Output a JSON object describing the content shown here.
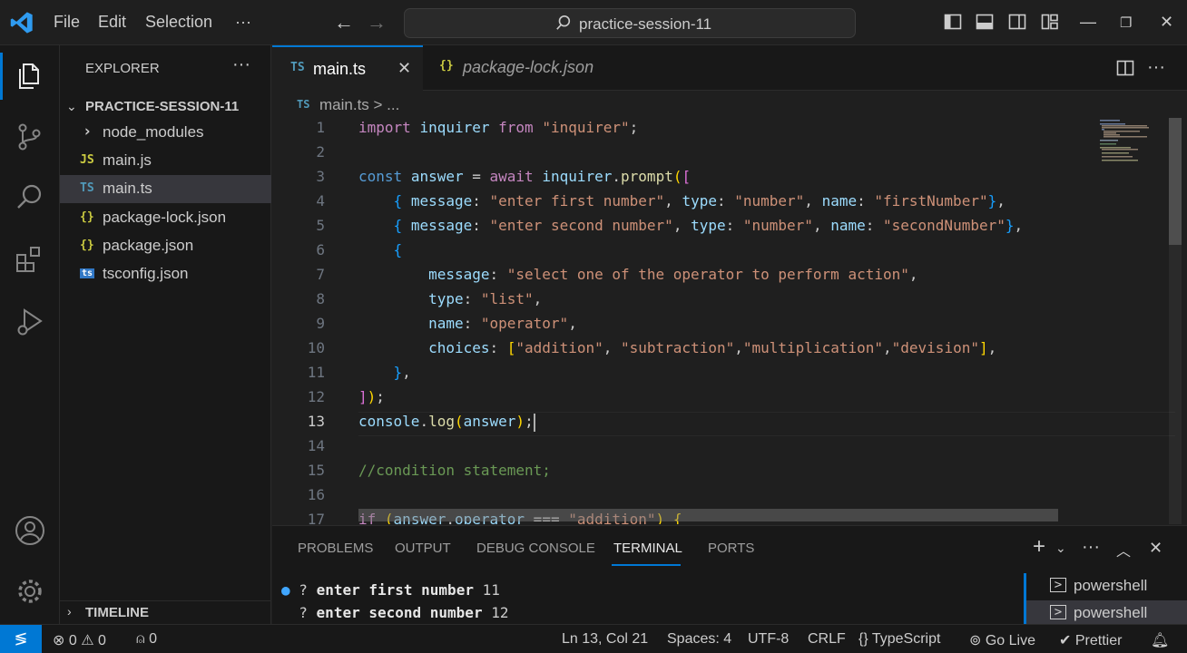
{
  "menu": {
    "file": "File",
    "edit": "Edit",
    "selection": "Selection",
    "more": "···"
  },
  "command_center": {
    "text": "practice-session-11"
  },
  "explorer": {
    "title": "EXPLORER",
    "more": "···",
    "folder": "PRACTICE-SESSION-11",
    "items": [
      {
        "icon": "›",
        "name": "node_modules"
      },
      {
        "icon": "JS",
        "name": "main.js"
      },
      {
        "icon": "TS",
        "name": "main.ts"
      },
      {
        "icon": "{}",
        "name": "package-lock.json"
      },
      {
        "icon": "{}",
        "name": "package.json"
      },
      {
        "icon": "ts",
        "name": "tsconfig.json"
      }
    ],
    "timeline": "TIMELINE"
  },
  "tabs": [
    {
      "icon": "TS",
      "label": "main.ts",
      "close": "✕"
    },
    {
      "icon": "{}",
      "label": "package-lock.json"
    }
  ],
  "breadcrumb": {
    "icon": "TS",
    "path": "main.ts > ..."
  },
  "editor": {
    "line_numbers": [
      "1",
      "2",
      "3",
      "4",
      "5",
      "6",
      "7",
      "8",
      "9",
      "10",
      "11",
      "12",
      "13",
      "14",
      "15",
      "16",
      "17"
    ],
    "lines": [
      "import inquirer from \"inquirer\";",
      "",
      "const answer = await inquirer.prompt([",
      "    { message: \"enter first number\", type: \"number\", name: \"firstNumber\"},",
      "    { message: \"enter second number\", type: \"number\", name: \"secondNumber\"},",
      "    {",
      "        message: \"select one of the operator to perform action\",",
      "        type: \"list\",",
      "        name: \"operator\",",
      "        choices: [\"addition\", \"subtraction\",\"multiplication\",\"devision\"],",
      "    },",
      "]);",
      "console.log(answer);",
      "",
      "//condition statement;",
      "",
      "if (answer.operator === \"addition\") {"
    ]
  },
  "panel": {
    "tabs": [
      "PROBLEMS",
      "OUTPUT",
      "DEBUG CONSOLE",
      "TERMINAL",
      "PORTS"
    ],
    "terminal_lines": [
      {
        "marker": "●",
        "prompt": "?",
        "text": "enter first number",
        "value": "11"
      },
      {
        "marker": "",
        "prompt": "?",
        "text": "enter second number",
        "value": "12"
      }
    ],
    "terminals": [
      "powershell",
      "powershell"
    ]
  },
  "status": {
    "errors": "0",
    "warnings": "0",
    "ports": "0",
    "position": "Ln 13, Col 21",
    "spaces": "Spaces: 4",
    "encoding": "UTF-8",
    "eol": "CRLF",
    "language": "TypeScript",
    "golive": "Go Live",
    "prettier": "Prettier"
  },
  "colors": {
    "accent": "#0078d4",
    "background": "#1f1f1f",
    "sidebar": "#181818"
  }
}
